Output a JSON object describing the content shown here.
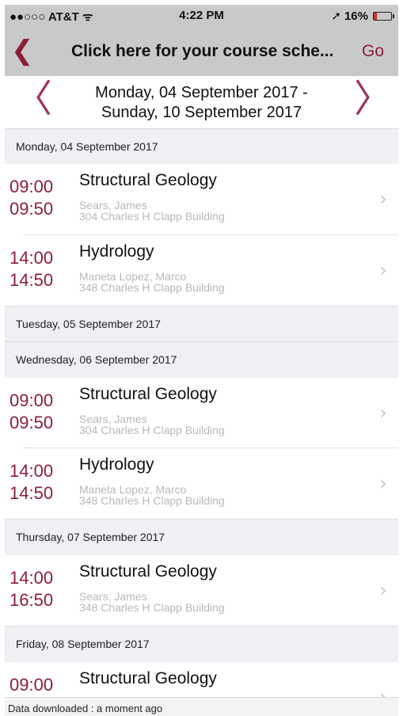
{
  "status_bar": {
    "carrier": "●●○○○ AT&T ᯤ",
    "time": "4:22 PM",
    "battery_text": "16%",
    "location_icon": "location-arrow-icon"
  },
  "nav": {
    "title": "Click here for your course sche...",
    "go_label": "Go",
    "back_icon": "chevron-left-icon"
  },
  "week": {
    "line1": "Monday, 04 September 2017 -",
    "line2": "Sunday, 10 September 2017"
  },
  "days": [
    {
      "header": "Monday, 04 September 2017",
      "events": [
        {
          "start": "09:00",
          "end": "09:50",
          "course": "Structural Geology",
          "instructor": "Sears, James",
          "location": "304 Charles H Clapp Building"
        },
        {
          "start": "14:00",
          "end": "14:50",
          "course": "Hydrology",
          "instructor": "Maneta Lopez, Marco",
          "location": "348 Charles H Clapp Building"
        }
      ]
    },
    {
      "header": "Tuesday, 05 September 2017",
      "events": []
    },
    {
      "header": "Wednesday, 06 September 2017",
      "events": [
        {
          "start": "09:00",
          "end": "09:50",
          "course": "Structural Geology",
          "instructor": "Sears, James",
          "location": "304 Charles H Clapp Building"
        },
        {
          "start": "14:00",
          "end": "14:50",
          "course": "Hydrology",
          "instructor": "Maneta Lopez, Marco",
          "location": "348 Charles H Clapp Building"
        }
      ]
    },
    {
      "header": "Thursday, 07 September 2017",
      "events": [
        {
          "start": "14:00",
          "end": "16:50",
          "course": "Structural Geology",
          "instructor": "Sears, James",
          "location": "348 Charles H Clapp Building"
        }
      ]
    },
    {
      "header": "Friday, 08 September 2017",
      "events": [
        {
          "start": "09:00",
          "course": "Structural Geology"
        }
      ]
    }
  ],
  "footer": {
    "text": "Data downloaded : a moment ago"
  },
  "colors": {
    "accent": "#8a1f38",
    "bar_background": "#c9c9c9",
    "section_background": "#efeff4",
    "secondary_text": "#b9b9b9"
  }
}
